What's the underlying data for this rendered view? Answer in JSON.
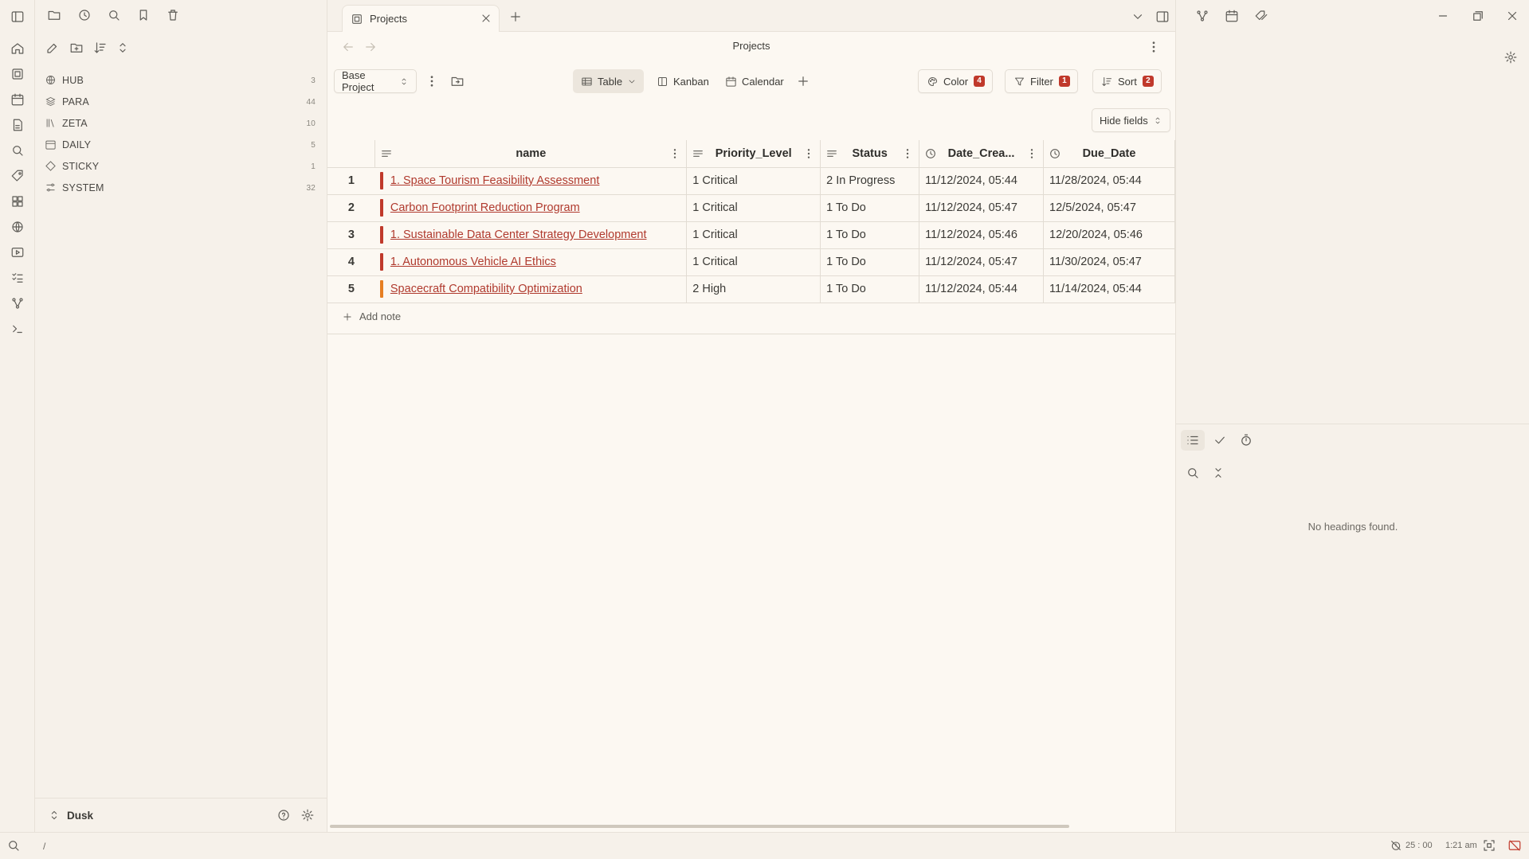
{
  "ribbon": {
    "icons": [
      "home-icon",
      "pages-icon",
      "calendar-icon",
      "document-icon",
      "search-icon",
      "tag-icon",
      "dashboard-icon",
      "globe-icon",
      "slides-icon",
      "tasks-icon",
      "graph-icon",
      "terminal-icon"
    ]
  },
  "sidebar": {
    "items": [
      {
        "label": "HUB",
        "count": "3"
      },
      {
        "label": "PARA",
        "count": "44"
      },
      {
        "label": "ZETA",
        "count": "10"
      },
      {
        "label": "DAILY",
        "count": "5"
      },
      {
        "label": "STICKY",
        "count": "1"
      },
      {
        "label": "SYSTEM",
        "count": "32"
      }
    ],
    "vault_name": "Dusk"
  },
  "tabs": [
    {
      "label": "Projects"
    }
  ],
  "view": {
    "title": "Projects",
    "base_select": "Base Project",
    "views": [
      {
        "label": "Table"
      },
      {
        "label": "Kanban"
      },
      {
        "label": "Calendar"
      }
    ],
    "color_label": "Color",
    "color_count": "4",
    "filter_label": "Filter",
    "filter_count": "1",
    "sort_label": "Sort",
    "sort_count": "2",
    "hide_fields": "Hide fields",
    "add_note": "Add note"
  },
  "table": {
    "columns": [
      "name",
      "Priority_Level",
      "Status",
      "Date_Crea...",
      "Due_Date"
    ],
    "rows": [
      {
        "num": "1",
        "name": "1. Space Tourism Feasibility Assessment",
        "priority": "1 Critical",
        "status": "2 In Progress",
        "created": "11/12/2024, 05:44",
        "due": "11/28/2024, 05:44",
        "color": "#c0392b"
      },
      {
        "num": "2",
        "name": "Carbon Footprint Reduction Program",
        "priority": "1 Critical",
        "status": "1 To Do",
        "created": "11/12/2024, 05:47",
        "due": "12/5/2024, 05:47",
        "color": "#c0392b"
      },
      {
        "num": "3",
        "name": "1. Sustainable Data Center Strategy Development",
        "priority": "1 Critical",
        "status": "1 To Do",
        "created": "11/12/2024, 05:46",
        "due": "12/20/2024, 05:46",
        "color": "#c0392b"
      },
      {
        "num": "4",
        "name": "1. Autonomous Vehicle AI Ethics",
        "priority": "1 Critical",
        "status": "1 To Do",
        "created": "11/12/2024, 05:47",
        "due": "11/30/2024, 05:47",
        "color": "#c0392b"
      },
      {
        "num": "5",
        "name": "Spacecraft Compatibility Optimization",
        "priority": "2 High",
        "status": "1 To Do",
        "created": "11/12/2024, 05:44",
        "due": "11/14/2024, 05:44",
        "color": "#e67e22"
      }
    ]
  },
  "outline": {
    "empty_text": "No headings found."
  },
  "statusbar": {
    "command": "/",
    "timer": "25 : 00",
    "clock": "1:21 am"
  }
}
